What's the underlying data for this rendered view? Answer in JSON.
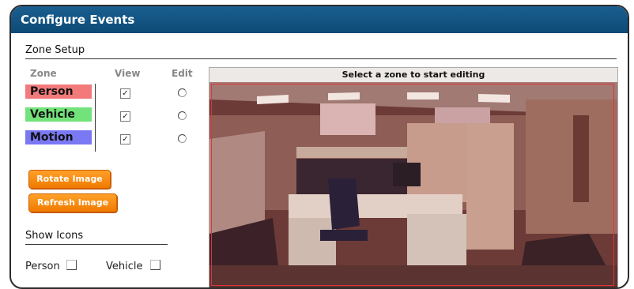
{
  "window": {
    "title": "Configure Events"
  },
  "zone_setup": {
    "title": "Zone Setup",
    "headers": {
      "zone": "Zone",
      "view": "View",
      "edit": "Edit"
    },
    "zones": [
      {
        "label": "Person",
        "color": "#f27a7a",
        "view_checked": true,
        "edit_selected": false
      },
      {
        "label": "Vehicle",
        "color": "#72e27a",
        "view_checked": true,
        "edit_selected": false
      },
      {
        "label": "Motion",
        "color": "#7a78f2",
        "view_checked": true,
        "edit_selected": false
      }
    ]
  },
  "buttons": {
    "rotate_label": "Rotate Image",
    "refresh_label": "Refresh Image"
  },
  "show_icons": {
    "title": "Show Icons",
    "person_label": "Person",
    "person_checked": false,
    "vehicle_label": "Vehicle",
    "vehicle_checked": false
  },
  "camera": {
    "banner": "Select a zone to start editing"
  },
  "check_glyph": "✓"
}
